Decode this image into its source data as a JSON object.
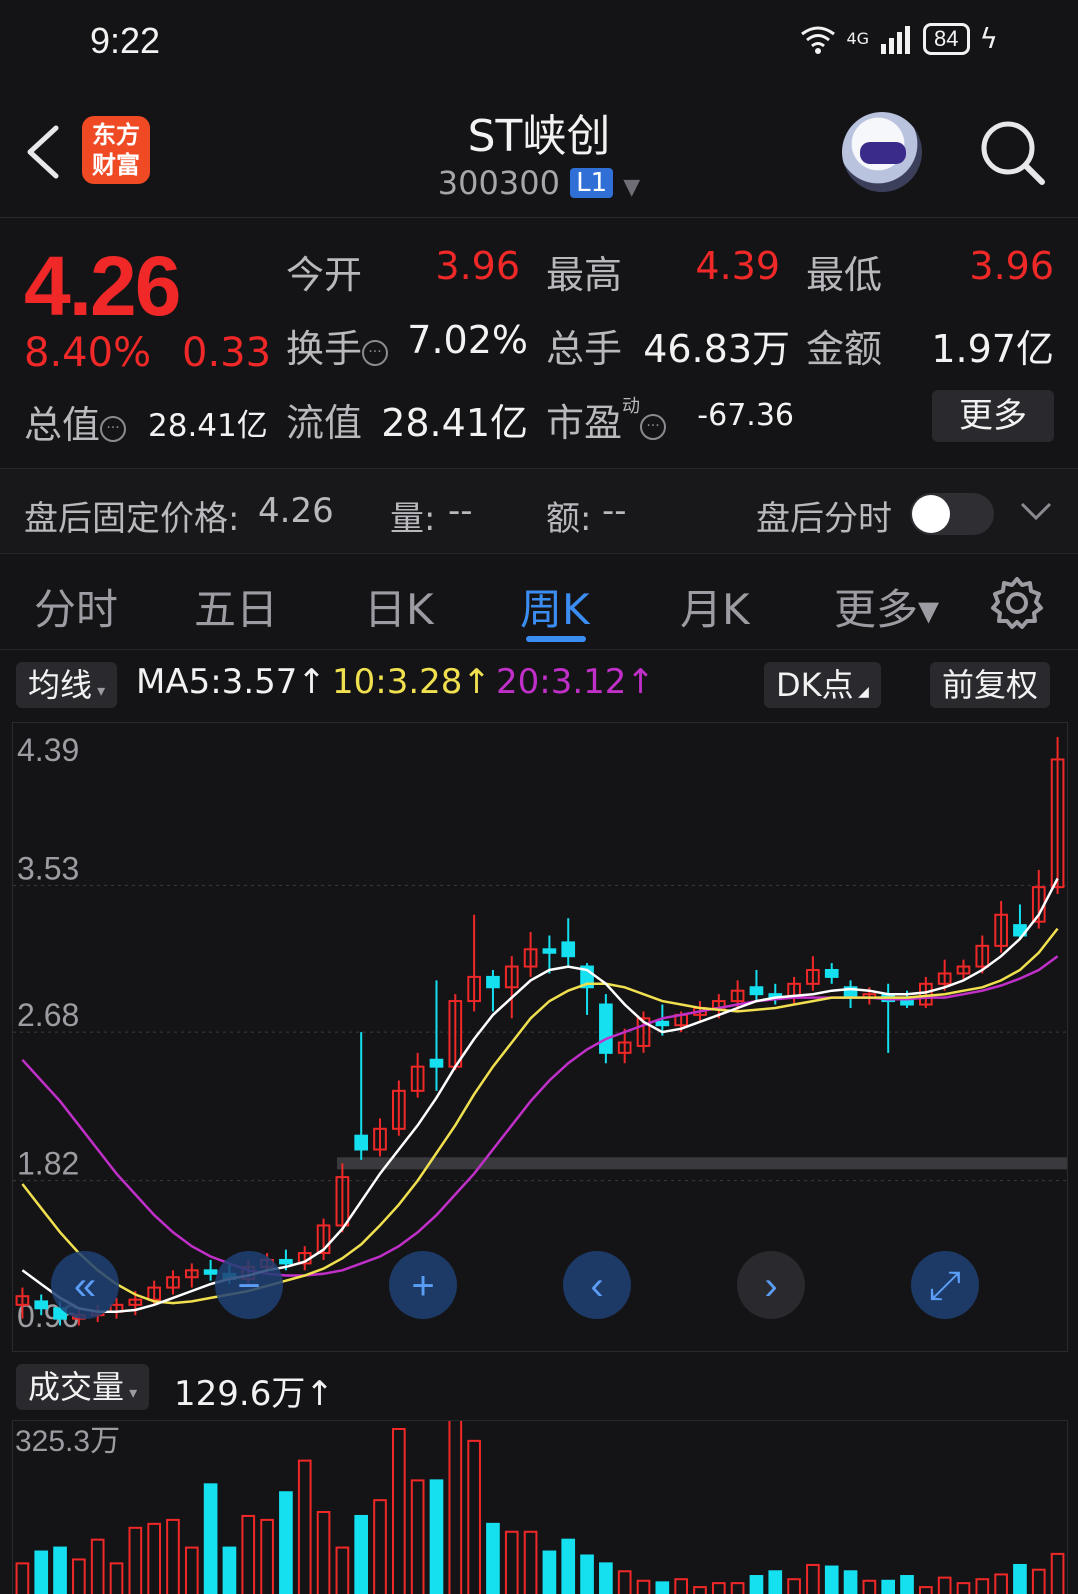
{
  "status_bar": {
    "time": "9:22",
    "network": "4G",
    "battery": "84"
  },
  "header": {
    "title": "ST峡创",
    "code": "300300",
    "level": "L1",
    "logo_text_line1": "东方",
    "logo_text_line2": "财富"
  },
  "quote": {
    "price": "4.26",
    "change_pct": "8.40%",
    "change_val": "0.33",
    "open_label": "今开",
    "open": "3.96",
    "high_label": "最高",
    "high": "4.39",
    "low_label": "最低",
    "low": "3.96",
    "turnover_label": "换手",
    "turnover": "7.02%",
    "volume_label": "总手",
    "volume": "46.83万",
    "amount_label": "金额",
    "amount": "1.97亿",
    "mcap_label": "总值",
    "mcap": "28.41亿",
    "float_label": "流值",
    "float": "28.41亿",
    "pe_label": "市盈",
    "pe_sup": "动",
    "pe": "-67.36",
    "more_label": "更多"
  },
  "after_hours": {
    "price_label": "盘后固定价格:",
    "price": "4.26",
    "volume_label": "量:",
    "volume": "--",
    "amount_label": "额:",
    "amount": "--",
    "toggle_label": "盘后分时"
  },
  "tabs": [
    {
      "label": "分时"
    },
    {
      "label": "五日"
    },
    {
      "label": "日K"
    },
    {
      "label": "周K"
    },
    {
      "label": "月K"
    },
    {
      "label": "更多▾"
    }
  ],
  "ma_bar": {
    "selector": "均线",
    "ma5": "MA5:3.57↑",
    "ma10": "10:3.28↑",
    "ma20": "20:3.12↑",
    "dk": "DK点",
    "adjust": "前复权"
  },
  "volume_header": {
    "selector": "成交量",
    "value": "129.6万↑"
  },
  "colors": {
    "up": "#f02828",
    "down": "#14e0f0",
    "ma5": "#ffffff",
    "ma10": "#f0e050",
    "ma20": "#c030c8",
    "accent": "#3b8df2"
  },
  "chart_data": {
    "type": "candlestick",
    "price_axis_ticks": [
      "4.39",
      "3.53",
      "2.68",
      "1.82",
      "0.96"
    ],
    "ylim": [
      0.96,
      4.39
    ],
    "candles": [
      {
        "o": 1.1,
        "h": 1.2,
        "l": 1.02,
        "c": 1.15
      },
      {
        "o": 1.12,
        "h": 1.16,
        "l": 1.04,
        "c": 1.08
      },
      {
        "o": 1.08,
        "h": 1.12,
        "l": 0.98,
        "c": 1.02
      },
      {
        "o": 1.02,
        "h": 1.08,
        "l": 0.98,
        "c": 1.04
      },
      {
        "o": 1.04,
        "h": 1.1,
        "l": 1.0,
        "c": 1.06
      },
      {
        "o": 1.06,
        "h": 1.14,
        "l": 1.02,
        "c": 1.1
      },
      {
        "o": 1.1,
        "h": 1.18,
        "l": 1.04,
        "c": 1.13
      },
      {
        "o": 1.13,
        "h": 1.24,
        "l": 1.1,
        "c": 1.2
      },
      {
        "o": 1.2,
        "h": 1.3,
        "l": 1.16,
        "c": 1.26
      },
      {
        "o": 1.26,
        "h": 1.34,
        "l": 1.2,
        "c": 1.3
      },
      {
        "o": 1.3,
        "h": 1.36,
        "l": 1.24,
        "c": 1.28
      },
      {
        "o": 1.28,
        "h": 1.34,
        "l": 1.22,
        "c": 1.25
      },
      {
        "o": 1.25,
        "h": 1.36,
        "l": 1.22,
        "c": 1.32
      },
      {
        "o": 1.32,
        "h": 1.4,
        "l": 1.28,
        "c": 1.36
      },
      {
        "o": 1.36,
        "h": 1.42,
        "l": 1.3,
        "c": 1.34
      },
      {
        "o": 1.34,
        "h": 1.44,
        "l": 1.3,
        "c": 1.4
      },
      {
        "o": 1.4,
        "h": 1.6,
        "l": 1.36,
        "c": 1.56
      },
      {
        "o": 1.56,
        "h": 1.92,
        "l": 1.52,
        "c": 1.84
      },
      {
        "o": 2.08,
        "h": 2.68,
        "l": 1.94,
        "c": 2.0
      },
      {
        "o": 2.0,
        "h": 2.18,
        "l": 1.96,
        "c": 2.12
      },
      {
        "o": 2.12,
        "h": 2.4,
        "l": 2.08,
        "c": 2.34
      },
      {
        "o": 2.34,
        "h": 2.56,
        "l": 2.3,
        "c": 2.48
      },
      {
        "o": 2.52,
        "h": 2.98,
        "l": 2.34,
        "c": 2.48
      },
      {
        "o": 2.48,
        "h": 2.9,
        "l": 2.46,
        "c": 2.86
      },
      {
        "o": 2.86,
        "h": 3.36,
        "l": 2.8,
        "c": 3.0
      },
      {
        "o": 3.0,
        "h": 3.04,
        "l": 2.8,
        "c": 2.94
      },
      {
        "o": 2.94,
        "h": 3.12,
        "l": 2.76,
        "c": 3.06
      },
      {
        "o": 3.06,
        "h": 3.26,
        "l": 3.0,
        "c": 3.16
      },
      {
        "o": 3.16,
        "h": 3.24,
        "l": 3.02,
        "c": 3.14
      },
      {
        "o": 3.2,
        "h": 3.34,
        "l": 3.06,
        "c": 3.12
      },
      {
        "o": 3.06,
        "h": 3.08,
        "l": 2.78,
        "c": 2.94
      },
      {
        "o": 2.84,
        "h": 2.9,
        "l": 2.5,
        "c": 2.56
      },
      {
        "o": 2.56,
        "h": 2.7,
        "l": 2.5,
        "c": 2.62
      },
      {
        "o": 2.6,
        "h": 2.8,
        "l": 2.56,
        "c": 2.76
      },
      {
        "o": 2.74,
        "h": 2.84,
        "l": 2.66,
        "c": 2.72
      },
      {
        "o": 2.72,
        "h": 2.8,
        "l": 2.68,
        "c": 2.78
      },
      {
        "o": 2.78,
        "h": 2.86,
        "l": 2.74,
        "c": 2.82
      },
      {
        "o": 2.82,
        "h": 2.9,
        "l": 2.76,
        "c": 2.86
      },
      {
        "o": 2.86,
        "h": 2.98,
        "l": 2.8,
        "c": 2.92
      },
      {
        "o": 2.94,
        "h": 3.04,
        "l": 2.86,
        "c": 2.9
      },
      {
        "o": 2.9,
        "h": 2.96,
        "l": 2.84,
        "c": 2.88
      },
      {
        "o": 2.88,
        "h": 3.0,
        "l": 2.84,
        "c": 2.96
      },
      {
        "o": 2.96,
        "h": 3.12,
        "l": 2.92,
        "c": 3.04
      },
      {
        "o": 3.04,
        "h": 3.08,
        "l": 2.96,
        "c": 3.0
      },
      {
        "o": 2.94,
        "h": 2.98,
        "l": 2.82,
        "c": 2.88
      },
      {
        "o": 2.88,
        "h": 2.94,
        "l": 2.84,
        "c": 2.9
      },
      {
        "o": 2.9,
        "h": 2.96,
        "l": 2.56,
        "c": 2.86
      },
      {
        "o": 2.86,
        "h": 2.92,
        "l": 2.82,
        "c": 2.84
      },
      {
        "o": 2.84,
        "h": 3.0,
        "l": 2.82,
        "c": 2.96
      },
      {
        "o": 2.96,
        "h": 3.1,
        "l": 2.92,
        "c": 3.02
      },
      {
        "o": 3.02,
        "h": 3.1,
        "l": 2.98,
        "c": 3.06
      },
      {
        "o": 3.06,
        "h": 3.24,
        "l": 3.02,
        "c": 3.18
      },
      {
        "o": 3.18,
        "h": 3.44,
        "l": 3.14,
        "c": 3.36
      },
      {
        "o": 3.3,
        "h": 3.42,
        "l": 3.22,
        "c": 3.24
      },
      {
        "o": 3.32,
        "h": 3.62,
        "l": 3.28,
        "c": 3.52
      },
      {
        "o": 3.52,
        "h": 4.39,
        "l": 3.48,
        "c": 4.26
      }
    ],
    "ma5": [
      1.3,
      1.22,
      1.14,
      1.08,
      1.06,
      1.06,
      1.07,
      1.1,
      1.14,
      1.18,
      1.22,
      1.25,
      1.27,
      1.3,
      1.32,
      1.35,
      1.42,
      1.54,
      1.7,
      1.86,
      2.0,
      2.14,
      2.3,
      2.48,
      2.64,
      2.78,
      2.88,
      2.98,
      3.04,
      3.06,
      3.04,
      2.96,
      2.84,
      2.74,
      2.68,
      2.7,
      2.74,
      2.78,
      2.82,
      2.86,
      2.88,
      2.89,
      2.9,
      2.92,
      2.93,
      2.92,
      2.9,
      2.9,
      2.91,
      2.94,
      2.98,
      3.04,
      3.12,
      3.22,
      3.36,
      3.57
    ],
    "ma10": [
      1.8,
      1.66,
      1.52,
      1.4,
      1.3,
      1.22,
      1.16,
      1.12,
      1.11,
      1.12,
      1.14,
      1.16,
      1.18,
      1.21,
      1.24,
      1.27,
      1.31,
      1.37,
      1.45,
      1.56,
      1.68,
      1.82,
      1.98,
      2.14,
      2.32,
      2.48,
      2.62,
      2.76,
      2.86,
      2.92,
      2.96,
      2.96,
      2.94,
      2.9,
      2.86,
      2.84,
      2.82,
      2.81,
      2.8,
      2.81,
      2.82,
      2.84,
      2.86,
      2.88,
      2.88,
      2.88,
      2.88,
      2.88,
      2.89,
      2.9,
      2.92,
      2.94,
      2.98,
      3.04,
      3.14,
      3.28
    ],
    "ma20": [
      2.52,
      2.4,
      2.28,
      2.14,
      2.0,
      1.86,
      1.74,
      1.62,
      1.52,
      1.44,
      1.38,
      1.34,
      1.3,
      1.28,
      1.27,
      1.27,
      1.28,
      1.3,
      1.34,
      1.38,
      1.44,
      1.52,
      1.62,
      1.74,
      1.86,
      2.0,
      2.14,
      2.28,
      2.4,
      2.5,
      2.58,
      2.64,
      2.68,
      2.72,
      2.76,
      2.78,
      2.8,
      2.82,
      2.84,
      2.86,
      2.87,
      2.88,
      2.88,
      2.88,
      2.88,
      2.88,
      2.87,
      2.87,
      2.88,
      2.88,
      2.9,
      2.92,
      2.95,
      2.99,
      3.04,
      3.12
    ],
    "volume_axis_top": "325.3万",
    "volumes": [
      40,
      55,
      60,
      45,
      70,
      40,
      85,
      90,
      95,
      60,
      140,
      60,
      100,
      95,
      130,
      170,
      105,
      60,
      100,
      120,
      210,
      145,
      145,
      230,
      195,
      90,
      80,
      80,
      55,
      70,
      50,
      40,
      30,
      18,
      16,
      20,
      10,
      15,
      15,
      24,
      30,
      20,
      38,
      36,
      30,
      18,
      18,
      24,
      10,
      22,
      15,
      20,
      26,
      38,
      32,
      52
    ]
  }
}
